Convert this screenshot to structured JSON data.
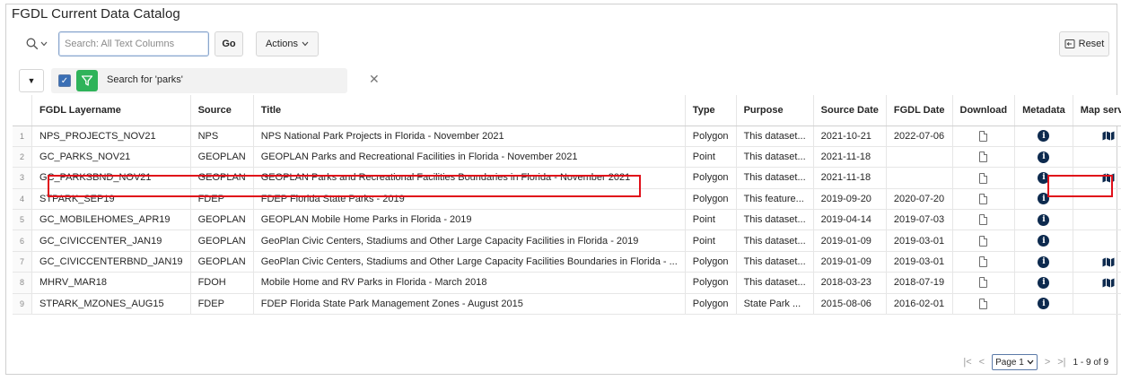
{
  "page": {
    "title": "FGDL Current Data Catalog"
  },
  "toolbar": {
    "search_placeholder": "Search: All Text Columns",
    "go_label": "Go",
    "actions_label": "Actions",
    "reset_label": "Reset"
  },
  "filter": {
    "text": "Search for 'parks'"
  },
  "table": {
    "headers": {
      "layername": "FGDL Layername",
      "source": "Source",
      "title": "Title",
      "type": "Type",
      "purpose": "Purpose",
      "source_date": "Source Date",
      "fgdl_date": "FGDL Date",
      "download": "Download",
      "metadata": "Metadata",
      "map_service": "Map service"
    },
    "rows": [
      {
        "n": "1",
        "layername": "NPS_PROJECTS_NOV21",
        "source": "NPS",
        "title": "NPS National Park Projects in Florida - November 2021",
        "type": "Polygon",
        "purpose": "This dataset...",
        "source_date": "2021-10-21",
        "fgdl_date": "2022-07-06",
        "map": true
      },
      {
        "n": "2",
        "layername": "GC_PARKS_NOV21",
        "source": "GEOPLAN",
        "title": "GEOPLAN Parks and Recreational Facilities in Florida - November 2021",
        "type": "Point",
        "purpose": "This dataset...",
        "source_date": "2021-11-18",
        "fgdl_date": "",
        "map": false
      },
      {
        "n": "3",
        "layername": "GC_PARKSBND_NOV21",
        "source": "GEOPLAN",
        "title": "GEOPLAN Parks and Recreational Facilities Boundaries in Florida - November 2021",
        "type": "Polygon",
        "purpose": "This dataset...",
        "source_date": "2021-11-18",
        "fgdl_date": "",
        "map": true
      },
      {
        "n": "4",
        "layername": "STPARK_SEP19",
        "source": "FDEP",
        "title": "FDEP Florida State Parks - 2019",
        "type": "Polygon",
        "purpose": "This feature...",
        "source_date": "2019-09-20",
        "fgdl_date": "2020-07-20",
        "map": false
      },
      {
        "n": "5",
        "layername": "GC_MOBILEHOMES_APR19",
        "source": "GEOPLAN",
        "title": "GEOPLAN Mobile Home Parks in Florida - 2019",
        "type": "Point",
        "purpose": "This dataset...",
        "source_date": "2019-04-14",
        "fgdl_date": "2019-07-03",
        "map": false
      },
      {
        "n": "6",
        "layername": "GC_CIVICCENTER_JAN19",
        "source": "GEOPLAN",
        "title": "GeoPlan Civic Centers, Stadiums and Other Large Capacity Facilities in Florida - 2019",
        "type": "Point",
        "purpose": "This dataset...",
        "source_date": "2019-01-09",
        "fgdl_date": "2019-03-01",
        "map": false
      },
      {
        "n": "7",
        "layername": "GC_CIVICCENTERBND_JAN19",
        "source": "GEOPLAN",
        "title": "GeoPlan Civic Centers, Stadiums and Other Large Capacity Facilities Boundaries in Florida - ...",
        "type": "Polygon",
        "purpose": "This dataset...",
        "source_date": "2019-01-09",
        "fgdl_date": "2019-03-01",
        "map": true
      },
      {
        "n": "8",
        "layername": "MHRV_MAR18",
        "source": "FDOH",
        "title": "Mobile Home and RV Parks in Florida - March 2018",
        "type": "Polygon",
        "purpose": "This dataset...",
        "source_date": "2018-03-23",
        "fgdl_date": "2018-07-19",
        "map": true
      },
      {
        "n": "9",
        "layername": "STPARK_MZONES_AUG15",
        "source": "FDEP",
        "title": "FDEP Florida State Park Management Zones - August 2015",
        "type": "Polygon",
        "purpose": "State Park ...",
        "source_date": "2015-08-06",
        "fgdl_date": "2016-02-01",
        "map": false
      }
    ]
  },
  "pagination": {
    "first": "|<",
    "prev": "<",
    "page_label": "Page 1",
    "next": ">",
    "last": ">|",
    "range": "1 - 9 of 9"
  },
  "colors": {
    "highlight": "#e0101a",
    "filter_green": "#2fb35a",
    "info_navy": "#0d2a4e"
  }
}
